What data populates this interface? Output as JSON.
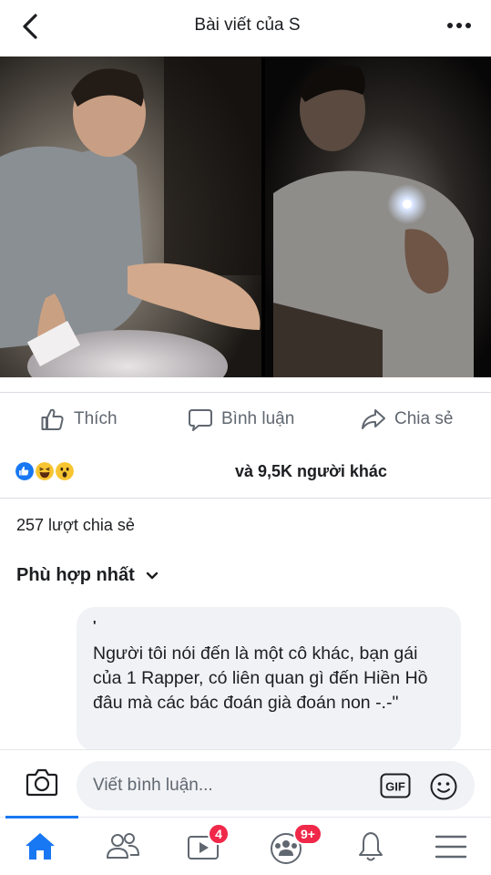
{
  "header": {
    "title": "Bài viết của S"
  },
  "actions": {
    "like": "Thích",
    "comment": "Bình luận",
    "share": "Chia sẻ"
  },
  "reactions": {
    "summary": "và 9,5K người khác"
  },
  "shares": {
    "text": "257 lượt chia sẻ"
  },
  "sort": {
    "label": "Phù hợp nhất"
  },
  "comment": {
    "author": "'",
    "text": "Người tôi nói đến là một cô khác, bạn gái của 1 Rapper, có liên quan gì đến Hiền Hồ đâu mà các bác đoán già đoán non -.-\""
  },
  "composer": {
    "placeholder": "Viết bình luận..."
  },
  "tabs": {
    "watch_badge": "4",
    "groups_badge": "9+"
  },
  "colors": {
    "accent": "#1877f2",
    "badge": "#f02849",
    "text_secondary": "#606770"
  }
}
